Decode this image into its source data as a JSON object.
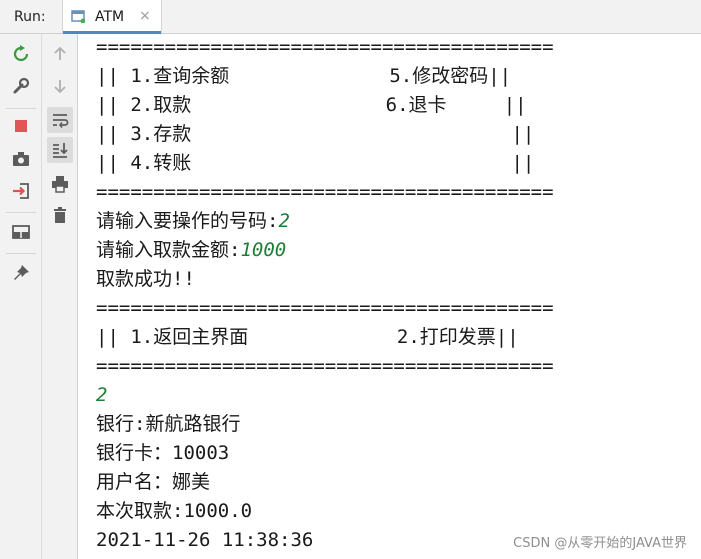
{
  "window": {
    "run_label": "Run:",
    "tab_label": "ATM",
    "tab_close": "×"
  },
  "toolbar_left": {
    "items": [
      {
        "name": "rerun-icon",
        "color": "#3d9a40"
      },
      {
        "name": "wrench-icon",
        "color": "#5c5c5c"
      },
      {
        "name": "stop-icon",
        "color": "#e05555"
      },
      {
        "name": "camera-icon",
        "color": "#5c5c5c"
      },
      {
        "name": "exit-icon",
        "color": "#d9534f"
      },
      {
        "name": "layout-icon",
        "color": "#5c5c5c"
      },
      {
        "name": "pin-icon",
        "color": "#5c5c5c"
      }
    ]
  },
  "toolbar_right": {
    "items": [
      {
        "name": "arrow-up-icon",
        "color": "#b0b0b0"
      },
      {
        "name": "arrow-down-icon",
        "color": "#b0b0b0"
      },
      {
        "name": "soft-wrap-icon",
        "color": "#5c5c5c"
      },
      {
        "name": "scroll-to-end-icon",
        "color": "#5c5c5c"
      },
      {
        "name": "print-icon",
        "color": "#5c5c5c"
      },
      {
        "name": "trash-icon",
        "color": "#5c5c5c"
      }
    ]
  },
  "console": {
    "lines": [
      {
        "text": "========================================"
      },
      {
        "text": "|| 1.查询余额              5.修改密码||"
      },
      {
        "text": "|| 2.取款                 6.退卡     ||"
      },
      {
        "text": "|| 3.存款                            ||"
      },
      {
        "text": "|| 4.转账                            ||"
      },
      {
        "text": "========================================"
      },
      {
        "prompt": "请输入要操作的号码:",
        "input": "2"
      },
      {
        "prompt": "请输入取款金额:",
        "input": "1000"
      },
      {
        "text": "取款成功!!"
      },
      {
        "text": "========================================"
      },
      {
        "text": "|| 1.返回主界面             2.打印发票||"
      },
      {
        "text": "========================================"
      },
      {
        "prompt": "",
        "input": "2"
      },
      {
        "text": "银行:新航路银行"
      },
      {
        "text": "银行卡：10003"
      },
      {
        "text": "用户名：娜美"
      },
      {
        "text": "本次取款:1000.0"
      },
      {
        "text": "2021-11-26 11:38:36"
      }
    ]
  },
  "watermark": "CSDN @从零开始的JAVA世界",
  "colors": {
    "user_input": "#1e7e34",
    "tab_accent": "#4a88c7"
  }
}
